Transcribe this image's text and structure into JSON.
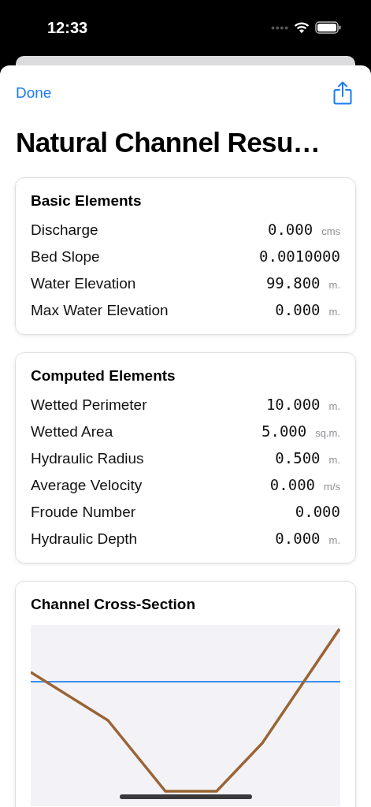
{
  "status_bar": {
    "time": "12:33"
  },
  "nav": {
    "done": "Done",
    "title": "Natural Channel Resu…"
  },
  "sections": [
    {
      "title": "Basic Elements",
      "rows": [
        {
          "label": "Discharge",
          "value": "0.000",
          "unit": "cms"
        },
        {
          "label": "Bed Slope",
          "value": "0.0010000"
        },
        {
          "label": "Water Elevation",
          "value": "99.800",
          "unit": "m."
        },
        {
          "label": "Max Water Elevation",
          "value": "0.000",
          "unit": "m."
        }
      ]
    },
    {
      "title": "Computed Elements",
      "rows": [
        {
          "label": "Wetted Perimeter",
          "value": "10.000",
          "unit": "m."
        },
        {
          "label": "Wetted Area",
          "value": "5.000",
          "unit": "sq.m."
        },
        {
          "label": "Hydraulic Radius",
          "value": "0.500",
          "unit": "m."
        },
        {
          "label": "Average Velocity",
          "value": "0.000",
          "unit": "m/s"
        },
        {
          "label": "Froude Number",
          "value": "0.000"
        },
        {
          "label": "Hydraulic Depth",
          "value": "0.000",
          "unit": "m."
        }
      ]
    }
  ],
  "cross_section": {
    "title": "Channel Cross-Section"
  }
}
